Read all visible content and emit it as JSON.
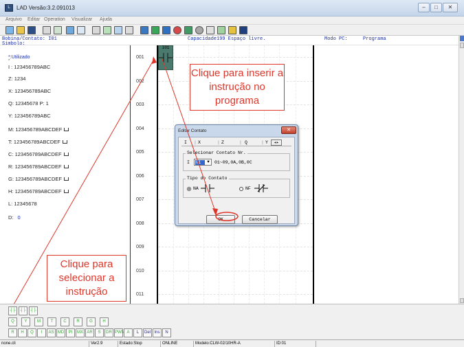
{
  "window": {
    "title": "LAD Versão:3.2.091013",
    "icon": "ladder-app-icon",
    "controls": [
      "minimize-icon",
      "restore-icon",
      "close-icon"
    ]
  },
  "menu": [
    "Arquivo",
    "Editar",
    "Operation",
    "Visualizar",
    "Ajuda"
  ],
  "toolbar": {
    "icons": [
      "new-file-icon",
      "open-icon",
      "save-icon",
      "print-icon",
      "preview-icon",
      "undo-icon",
      "redo-icon",
      "cut-icon",
      "copy-icon",
      "paste-icon",
      "monitor-icon",
      "read-icon",
      "write-icon",
      "run-icon",
      "stop-icon",
      "compare-icon",
      "key-icon",
      "help-icon",
      "about-icon"
    ]
  },
  "header": {
    "coil_label": "Bobina/Contato: I01",
    "symbol_label": "Símbolo:",
    "capacity": "Capacidade199 Espaço livre.",
    "pc_mode_label": "Modo PC:",
    "pc_mode_value": "Programa"
  },
  "left_panel": {
    "used_label": "*:Utilizado",
    "rows": [
      {
        "text": "I : 123456789ABC",
        "more": false
      },
      {
        "text": "Z: 1234",
        "more": false
      },
      {
        "text": "X: 123456789ABC",
        "more": false
      },
      {
        "text": "Q: 12345678  P: 1",
        "more": false
      },
      {
        "text": "Y: 123456789ABC",
        "more": false
      },
      {
        "text": "M: 123456789ABCDEF",
        "more": true
      },
      {
        "text": "T: 123456789ABCDEF",
        "more": true
      },
      {
        "text": "C: 123456789ABCDEF",
        "more": true
      },
      {
        "text": "R: 123456789ABCDEF",
        "more": true
      },
      {
        "text": "G: 123456789ABCDEF",
        "more": true
      },
      {
        "text": "H: 123456789ABCDEF",
        "more": true
      },
      {
        "text": "L: 12345678",
        "more": false
      },
      {
        "text": "D:",
        "more": false,
        "value": "0"
      }
    ]
  },
  "ladder": {
    "line_numbers": [
      "001",
      "002",
      "003",
      "004",
      "005",
      "006",
      "007",
      "008",
      "009",
      "010",
      "011"
    ],
    "contact_label": "I01"
  },
  "dialog": {
    "title": "Editar Contato",
    "tabs": [
      "I",
      "X",
      "Z",
      "Q",
      "Y"
    ],
    "select_group": "Selecionar Contato Nr.",
    "prefix": "I",
    "selected_value": "01",
    "range_hint": "01~09,0A,0B,0C",
    "type_group": "Tipo do Contato",
    "type_no": "NA",
    "type_nc": "NF",
    "selected_type": "NA",
    "ok_label": "OK",
    "cancel_label": "Cancelar"
  },
  "annotations": {
    "insert": "Clique para inserir a instrução no programa",
    "select": "Clique para selecionar a instrução",
    "color": "#e0362a"
  },
  "palette": {
    "row1": [
      "contact-no",
      "contact-nc",
      "rising-edge"
    ],
    "row2": [
      "Q",
      "Y",
      "M",
      "T",
      "C",
      "R",
      "G",
      "H"
    ],
    "row3": [
      "R",
      "H",
      "Q",
      "I",
      "AS",
      "MD",
      "PI",
      "MX",
      "AR",
      "S",
      "DR",
      "PWM",
      "A",
      "L",
      "Del",
      "Ins",
      "N"
    ]
  },
  "statusbar": {
    "file": "none.cli",
    "version": "Ver2.9",
    "state": "Estado:Stop",
    "connection": "ONLINE",
    "model": "Modelo:CLW-02/10HR-A",
    "id": "ID:01"
  }
}
